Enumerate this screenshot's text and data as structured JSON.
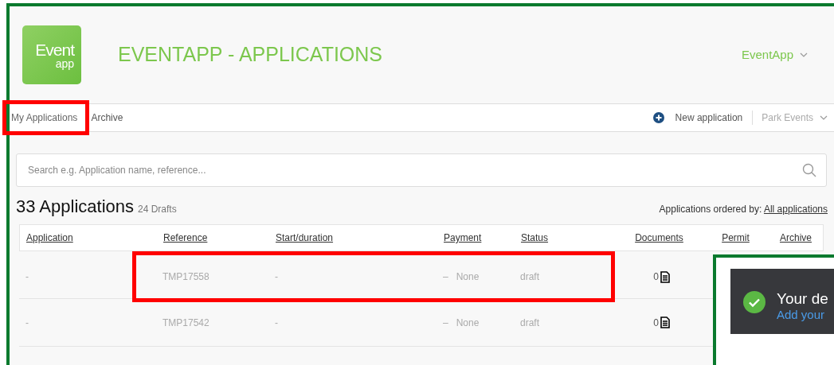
{
  "header": {
    "logo": {
      "line_1": "Event",
      "line_2": "app"
    },
    "title": "EVENTAPP - APPLICATIONS",
    "account_menu": "EventApp"
  },
  "tabs": [
    {
      "label": "My Applications",
      "selected": true,
      "highlighted": true
    },
    {
      "label": "Archive",
      "selected": false,
      "highlighted": false
    }
  ],
  "actions": {
    "new_application": "New application",
    "organisation_menu": "Park Events"
  },
  "search": {
    "placeholder": "Search e.g. Application name, reference..."
  },
  "summary": {
    "count": "33 Applications",
    "drafts": "24 Drafts",
    "order_label": "Applications ordered by:",
    "order_link": "All applications"
  },
  "table": {
    "columns": [
      "Application",
      "Reference",
      "Start/duration",
      "Payment",
      "Status",
      "Documents",
      "Permit",
      "Archive"
    ],
    "rows": [
      {
        "application": "-",
        "reference": "TMP17558",
        "start_duration": "-",
        "payment_mark": "–",
        "payment": "None",
        "status": "draft",
        "documents": "0",
        "highlighted": true
      },
      {
        "application": "-",
        "reference": "TMP17542",
        "start_duration": "-",
        "payment_mark": "–",
        "payment": "None",
        "status": "draft",
        "documents": "0",
        "highlighted": false
      }
    ]
  },
  "toast": {
    "title": "Your de",
    "link": "Add your"
  }
}
